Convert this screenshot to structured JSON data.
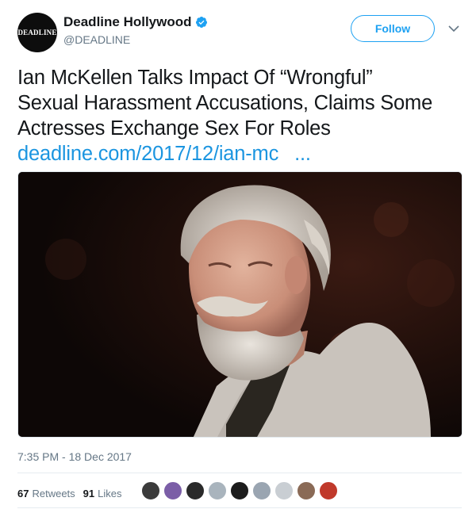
{
  "account": {
    "avatar_text": "DEADLINE",
    "display_name": "Deadline Hollywood",
    "handle": "@DEADLINE",
    "verified_icon": "verified-badge-icon"
  },
  "actions": {
    "follow_label": "Follow",
    "more_icon": "chevron-down-icon"
  },
  "tweet": {
    "lines": [
      "Ian McKellen Talks Impact Of “Wrongful”",
      "Sexual Harassment Accusations, Claims Some",
      "Actresses Exchange Sex For Roles"
    ],
    "link": "deadline.com/2017/12/ian-mc",
    "link_ellipsis": "..."
  },
  "media": {
    "alt": "Photo of Ian McKellen"
  },
  "timestamp": "7:35 PM - 18 Dec 2017",
  "stats": {
    "retweets_count": "67",
    "retweets_label": "Retweets",
    "likes_count": "91",
    "likes_label": "Likes"
  },
  "likers": [
    {
      "color": "#3b3b3b"
    },
    {
      "color": "#7b5ea7"
    },
    {
      "color": "#2a2a2a"
    },
    {
      "color": "#a9b4bd"
    },
    {
      "color": "#1c1c1c"
    },
    {
      "color": "#9aa5b1"
    },
    {
      "color": "#c9ced3"
    },
    {
      "color": "#8a6a56"
    },
    {
      "color": "#c0392b"
    }
  ],
  "colors": {
    "accent": "#1da1f2",
    "link": "#1b95e0",
    "muted": "#657786"
  }
}
